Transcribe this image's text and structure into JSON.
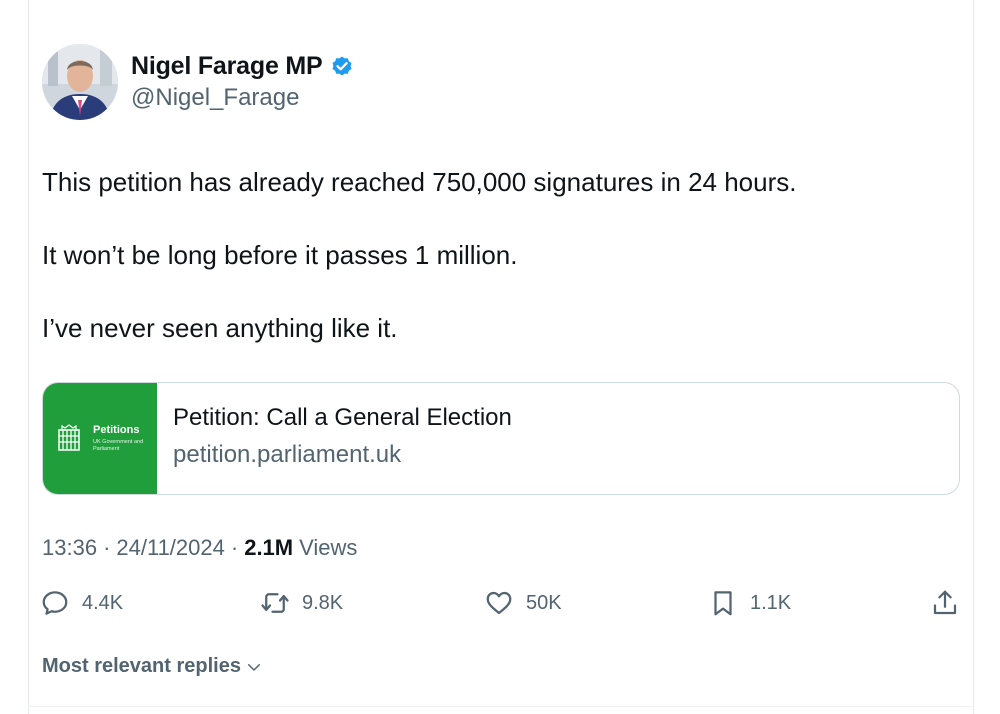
{
  "author": {
    "display_name": "Nigel Farage MP",
    "handle": "@Nigel_Farage",
    "verified_color": "#1d9bf0"
  },
  "post": {
    "lines": [
      "This petition has already reached 750,000 signatures in 24 hours.",
      "It won’t be long before it passes 1 million.",
      "I’ve never seen anything like it."
    ]
  },
  "link_card": {
    "thumb_title": "Petitions",
    "thumb_subtitle": "UK Government and Parliament",
    "title": "Petition: Call a General Election",
    "domain": "petition.parliament.uk",
    "thumb_color": "#1f9e3b"
  },
  "meta": {
    "time": "13:36",
    "date": "24/11/2024",
    "separator": "·",
    "views_count": "2.1M",
    "views_label": "Views"
  },
  "actions": {
    "replies": "4.4K",
    "reposts": "9.8K",
    "likes": "50K",
    "bookmarks": "1.1K",
    "icons": [
      "reply-icon",
      "repost-icon",
      "like-icon",
      "bookmark-icon",
      "share-icon"
    ]
  },
  "replies_sort": {
    "label": "Most relevant replies"
  }
}
